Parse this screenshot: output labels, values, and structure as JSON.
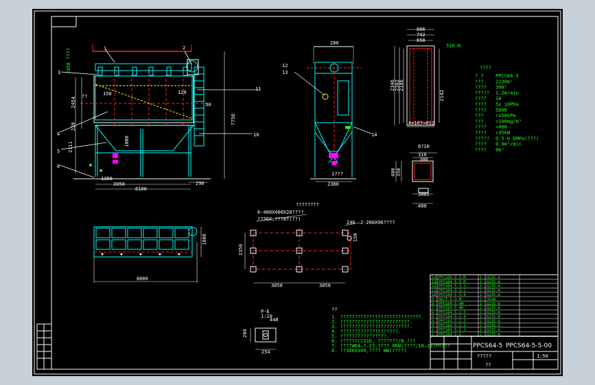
{
  "window": {
    "background": "#000000",
    "frame_color": "#ffffff",
    "bg_outer": "#c8d0d8"
  },
  "colors": {
    "line": "#ffffff",
    "dim": "#00ff00",
    "cyan": "#00ffff",
    "red": "#ff2020",
    "yellow": "#ffff00",
    "magenta": "#ff00ff"
  },
  "front_view": {
    "height_top": "2458 ????",
    "labels": [
      "1",
      "2",
      "3",
      "4",
      "5",
      "6",
      "10",
      "11"
    ],
    "dims": {
      "d150": "150",
      "d120": "120",
      "d220": "220",
      "d2454": "2454",
      "d2111": "2111",
      "d7750": "7750",
      "d1000": "1000",
      "d1350": "1350",
      "d3050": "3050",
      "d6100": "6100",
      "d290": "290",
      "d30": "30",
      "d1x": "??"
    }
  },
  "side_view": {
    "width": "280",
    "labels": {
      "l12": "12",
      "l13": "13",
      "l14": "14",
      "bottom": "1???",
      "w2380": "2380"
    }
  },
  "detail_right": {
    "dims": {
      "d806": "806",
      "d742": "742",
      "d658": "658",
      "d2346": "2346",
      "d2302": "2302",
      "d2186": "2186",
      "d2142": "2142",
      "d107": "8x107=812"
    },
    "top_label": "5th-N",
    "flange": {
      "d310": "310",
      "d300": "300",
      "d400a": "400",
      "d400b": "400",
      "d350": "350",
      "d3005": "3005",
      "label": "8?10"
    }
  },
  "spec_table": {
    "title": "????",
    "rows": [
      [
        "? ?",
        "PPCS64-5"
      ],
      [
        "???",
        "2230m²"
      ],
      [
        "????",
        "30m²"
      ],
      [
        "?????",
        "1.2m/min"
      ],
      [
        "????",
        "10"
      ],
      [
        "????",
        "5x 10PDa"
      ],
      [
        "????",
        "5000"
      ],
      [
        "???",
        "<150kPa"
      ],
      [
        "???",
        "<100mg/m³"
      ],
      [
        "????",
        "<400"
      ],
      [
        "????",
        "<35kW"
      ],
      [
        "?????",
        "0.5-0.6MPa(???)"
      ],
      [
        "????",
        "0.9m³/min"
      ],
      [
        "????",
        "9m³"
      ]
    ]
  },
  "top_view": {
    "width": "8000",
    "depth": "1800"
  },
  "foundation": {
    "note1": "????????",
    "note2": "6-400X400X20????",
    "note3": "??36X,???8T(??)",
    "note4": "2-200X96????",
    "d240": "240",
    "d2350": "2350",
    "d3050a": "3050",
    "d3050b": "3050",
    "d150": "150"
  },
  "section": {
    "title": "P-E",
    "scale": "1:10",
    "d254": "254",
    "d204": "204",
    "d448": "448"
  },
  "notes": {
    "title": "??",
    "lines": [
      "1. ????????????????????????????.",
      "2. ????????????????????????.",
      "3. ????????????????????????.",
      "4. ????????????????????.",
      "5. ????????????????.",
      "6. ??????(S31D, ???????/N.???",
      "7. ????WD4—?-23,???? 8KW(????/18—23)P=???",
      "8. ??300X300,???? WW(????)"
    ]
  },
  "bom": {
    "rows": [
      [
        "14",
        "PPCS64-5-3-M",
        "1",
        "Q235-A"
      ],
      [
        "13",
        "PPCS64-5-3-M",
        "1",
        "Q235-A"
      ],
      [
        "12",
        "PPCS64-5-3-2",
        "1",
        "Q235-A"
      ],
      [
        "11",
        "PPCS64-5-3-1",
        "1",
        "Q235-A"
      ],
      [
        "10",
        "PPCS64-5-3-0",
        "1",
        "Q235-A"
      ],
      [
        "9",
        "GB/T 5-3-M",
        "1",
        "35kW"
      ],
      [
        "8",
        "PPCS64-5-4M",
        "1",
        "Q235-A"
      ],
      [
        "7",
        "PPCS64-5-4H",
        "1",
        "Q235-A"
      ],
      [
        "6",
        "PPCS64-5-2-5",
        "1",
        "Q235-A"
      ],
      [
        "5",
        "PPCS64-5-2-4",
        "1",
        "Q235-A"
      ],
      [
        "4",
        "PPCS64-5-2-3",
        "1",
        "Q235-A"
      ],
      [
        "3",
        "PPCS64-5-2-2",
        "1",
        "Q235-A"
      ],
      [
        "2",
        "PPCS64-5-2-1",
        "1",
        "Q235-A"
      ],
      [
        "1",
        "PPCS64-5-1",
        "1",
        "Q235-A"
      ]
    ],
    "model": "PPCS64-5",
    "drawing_no": "PPCS64-5-5-00",
    "name": "?????",
    "footer": "??",
    "scale": "1:50"
  }
}
